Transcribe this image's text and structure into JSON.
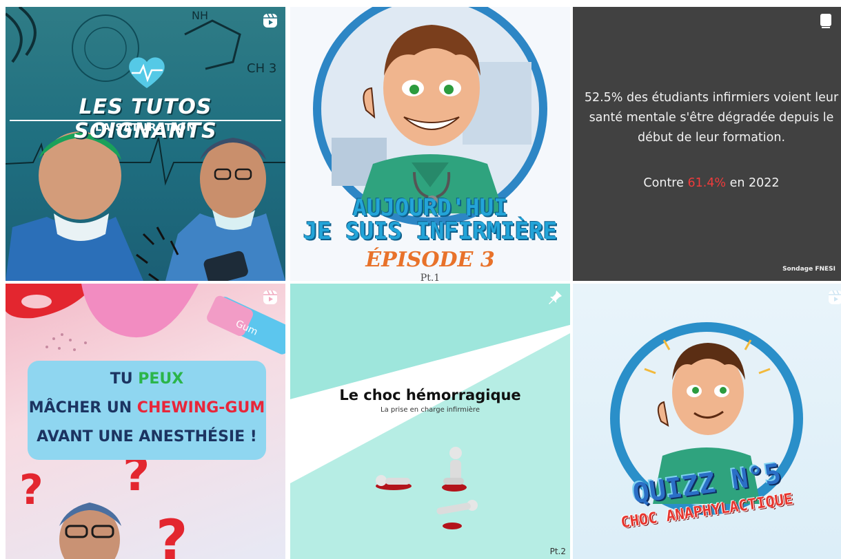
{
  "posts": [
    {
      "title": "LES TUTOS SOIGNANTS",
      "subtitle": "LA SATURATION",
      "badge_icon": "reels-icon",
      "colors": {
        "bg": "#1f6f80",
        "accent": "#4fd0e0"
      }
    },
    {
      "line1": "AUJOURD'HUI",
      "line2": "JE SUIS INFIRMIÈRE",
      "episode": "ÉPISODE 3",
      "part": "Pt.1",
      "colors": {
        "title": "#23a4d8",
        "episode": "#e8722a"
      }
    },
    {
      "text": "52.5% des étudiants infirmiers voient leur santé mentale s'être dégradée depuis le début de leur formation.",
      "contre_before": "Contre ",
      "contre_value": "61.4%",
      "contre_after": " en 2022",
      "source": "Sondage FNESI",
      "badge_icon": "carousel-icon",
      "colors": {
        "bg": "#414141",
        "highlight": "#ef3b3b"
      }
    },
    {
      "line1_a": "TU ",
      "line1_b": "PEUX",
      "line2_a": "MÂCHER UN ",
      "line2_b": "CHEWING-GUM",
      "line3": "AVANT UNE ANESTHÉSIE !",
      "gum_label": "Gum",
      "badge_icon": "reels-icon",
      "colors": {
        "card": "#8fd6f0",
        "text": "#1c3461",
        "green": "#2bb54a",
        "red": "#e8263a"
      }
    },
    {
      "title": "Le choc hémorragique",
      "subtitle": "La prise en charge infirmière",
      "part": "Pt.2",
      "badge_icon": "pin-icon",
      "colors": {
        "teal": "#9ee6dc",
        "blood": "#b3131b"
      }
    },
    {
      "title": "QUIZZ N°5",
      "subtitle": "CHOC ANAPHYLACTIQUE",
      "badge_icon": "reels-icon",
      "colors": {
        "ring": "#2a8fc9",
        "title": "#2b6fc6",
        "subtitle": "#e7362f"
      }
    }
  ]
}
